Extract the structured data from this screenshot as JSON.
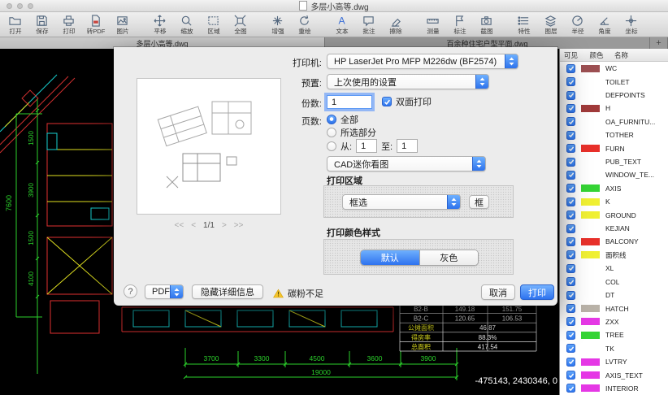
{
  "window": {
    "title": "多层小高等.dwg",
    "accent_color": "#3d87f6"
  },
  "toolbar": {
    "items": [
      {
        "label": "打开"
      },
      {
        "label": "保存"
      },
      {
        "label": "打印"
      },
      {
        "label": "转PDF"
      },
      {
        "label": "图片"
      },
      {
        "label": "平移"
      },
      {
        "label": "缩放"
      },
      {
        "label": "区域"
      },
      {
        "label": "全图"
      },
      {
        "label": "增强"
      },
      {
        "label": "重绘"
      },
      {
        "label": "文本"
      },
      {
        "label": "批注"
      },
      {
        "label": "擦除"
      },
      {
        "label": "测量"
      },
      {
        "label": "标注"
      },
      {
        "label": "截图"
      },
      {
        "label": "特性"
      },
      {
        "label": "图层"
      },
      {
        "label": "半径"
      },
      {
        "label": "角度"
      },
      {
        "label": "坐标"
      }
    ]
  },
  "tabs": {
    "active_label": "多层小高等.dwg",
    "inactive_label": "百余种住宅户型平面.dwg",
    "new_tab_label": "+"
  },
  "print_dialog": {
    "printer_label": "打印机:",
    "printer_value": "HP LaserJet Pro MFP M226dw (BF2574)",
    "presets_label": "预置:",
    "presets_value": "上次使用的设置",
    "copies_label": "份数:",
    "copies_value": "1",
    "two_sided_label": "双面打印",
    "pages_label": "页数:",
    "pages_all_label": "全部",
    "pages_selection_label": "所选部分",
    "pages_from_label": "从:",
    "pages_from_value": "1",
    "pages_to_label": "至:",
    "pages_to_value": "1",
    "app_section_value": "CAD迷你看图",
    "print_area_title": "打印区域",
    "area_mode_value": "框选",
    "area_pick_button": "框",
    "color_style_title": "打印颜色样式",
    "color_default_label": "默认",
    "color_gray_label": "灰色",
    "nav_first": "<<",
    "nav_prev": "<",
    "page_indicator": "1/1",
    "nav_next": ">",
    "nav_last": ">>",
    "help_label": "?",
    "pdf_label": "PDF",
    "hide_details_label": "隐藏详细信息",
    "toner_warning": "碳粉不足",
    "cancel_label": "取消",
    "print_label": "打印"
  },
  "layers_panel": {
    "headers": {
      "visible": "可见",
      "color": "颜色",
      "name": "名称"
    },
    "rows": [
      {
        "name": "WC",
        "swatch": "#9c4f52"
      },
      {
        "name": "TOILET",
        "swatch": "#ffffff"
      },
      {
        "name": "DEFPOINTS",
        "swatch": "#ffffff"
      },
      {
        "name": "H",
        "swatch": "#a03a3a"
      },
      {
        "name": "OA_FURNITU...",
        "swatch": "#ffffff"
      },
      {
        "name": "TOTHER",
        "swatch": "#ffffff"
      },
      {
        "name": "FURN",
        "swatch": "#e8302a"
      },
      {
        "name": "PUB_TEXT",
        "swatch": "#ffffff"
      },
      {
        "name": "WINDOW_TE...",
        "swatch": "#ffffff"
      },
      {
        "name": "AXIS",
        "swatch": "#35d435"
      },
      {
        "name": "K",
        "swatch": "#f0f032"
      },
      {
        "name": "GROUND",
        "swatch": "#f0f032"
      },
      {
        "name": "KEJIAN",
        "swatch": "#ffffff"
      },
      {
        "name": "BALCONY",
        "swatch": "#e8302a"
      },
      {
        "name": "面积线",
        "swatch": "#f0f032"
      },
      {
        "name": "XL",
        "swatch": "#ffffff"
      },
      {
        "name": "COL",
        "swatch": "#ffffff"
      },
      {
        "name": "DT",
        "swatch": "#ffffff"
      },
      {
        "name": "HATCH",
        "swatch": "#b9b2a8"
      },
      {
        "name": "ZXX",
        "swatch": "#e538e5"
      },
      {
        "name": "TREE",
        "swatch": "#35d435"
      },
      {
        "name": "TK",
        "swatch": "#ffffff"
      },
      {
        "name": "LVTRY",
        "swatch": "#e538e5"
      },
      {
        "name": "AXIS_TEXT",
        "swatch": "#e538e5"
      },
      {
        "name": "INTERIOR",
        "swatch": "#e538e5"
      }
    ]
  },
  "canvas": {
    "coordinates_readout": "-475143, 2430346, 0",
    "bottom_dims": [
      "3700",
      "3300",
      "4500",
      "3600",
      "3900"
    ],
    "total_dim": "19000",
    "left_dims": [
      "1500",
      "3900",
      "1500",
      "4100"
    ],
    "left_dim_major": "7600",
    "area_table": {
      "rows": [
        {
          "label": "B2-B",
          "v1": "149.18",
          "v2": "151.75"
        },
        {
          "label": "B2-C",
          "v1": "120.65",
          "v2": "106.53"
        },
        {
          "label": "公摊面积",
          "v1": "46.87",
          "v2": ""
        },
        {
          "label": "得房率",
          "v1": "88.3%",
          "v2": ""
        },
        {
          "label": "总面积",
          "v1": "417.54",
          "v2": ""
        }
      ]
    }
  }
}
